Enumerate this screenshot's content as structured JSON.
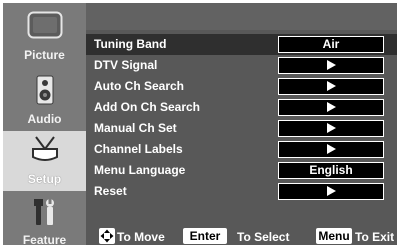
{
  "sidebar": {
    "items": [
      {
        "label": "Picture",
        "icon": "picture-icon",
        "active": false
      },
      {
        "label": "Audio",
        "icon": "speaker-icon",
        "active": false
      },
      {
        "label": "Setup",
        "icon": "antenna-icon",
        "active": true
      },
      {
        "label": "Feature",
        "icon": "tools-icon",
        "active": false
      }
    ]
  },
  "menu": {
    "rows": [
      {
        "label": "Tuning Band",
        "value": "Air",
        "type": "value",
        "selected": true
      },
      {
        "label": "DTV Signal",
        "value": "",
        "type": "arrow",
        "selected": false
      },
      {
        "label": "Auto Ch Search",
        "value": "",
        "type": "arrow",
        "selected": false
      },
      {
        "label": "Add On Ch Search",
        "value": "",
        "type": "arrow",
        "selected": false
      },
      {
        "label": "Manual Ch Set",
        "value": "",
        "type": "arrow",
        "selected": false
      },
      {
        "label": "Channel Labels",
        "value": "",
        "type": "arrow",
        "selected": false
      },
      {
        "label": "Menu Language",
        "value": "English",
        "type": "value",
        "selected": false
      },
      {
        "label": "Reset",
        "value": "",
        "type": "arrow",
        "selected": false
      }
    ]
  },
  "footer": {
    "move_text": "To Move",
    "enter_key": "Enter",
    "select_text": "To Select",
    "menu_key": "Menu",
    "exit_text": "To Exit"
  },
  "colors": {
    "sidebar_bg": "#7a7a7a",
    "sidebar_active_bg": "#d9d9d9",
    "panel_bg": "#585858",
    "selected_row_bg": "#2f2f2f",
    "value_box_bg": "#000000",
    "text": "#ffffff"
  }
}
